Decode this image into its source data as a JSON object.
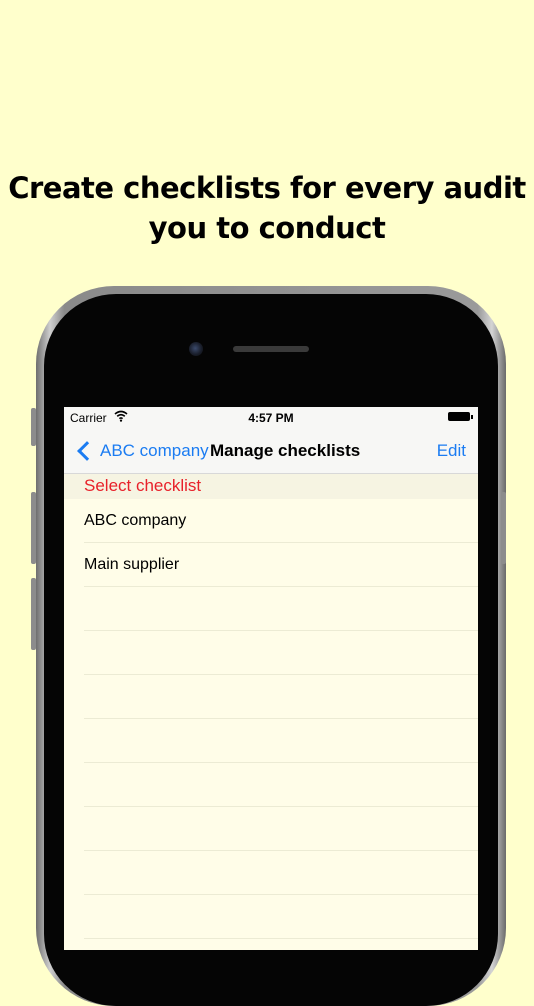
{
  "headline": {
    "line1": "Create checklists for every audit",
    "line2": "you to conduct"
  },
  "status_bar": {
    "carrier": "Carrier",
    "time": "4:57 PM"
  },
  "nav": {
    "back_label": "ABC company",
    "title": "Manage checklists",
    "edit_label": "Edit"
  },
  "section": {
    "header": "Select checklist"
  },
  "checklists": [
    "ABC company",
    "Main supplier"
  ],
  "colors": {
    "background": "#ffffcc",
    "accent": "#1b7cf2",
    "section_header": "#e8212a"
  },
  "icons": {
    "wifi": "wifi-icon",
    "battery": "battery-icon",
    "back": "chevron-left-icon"
  }
}
